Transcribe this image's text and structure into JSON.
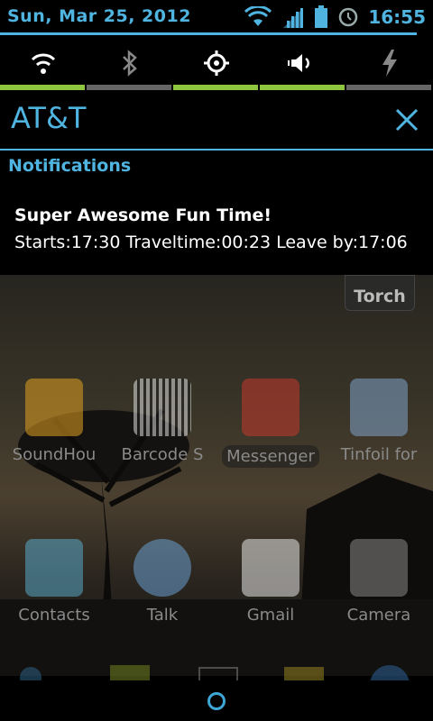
{
  "status_bar": {
    "date": "Sun, Mar 25, 2012",
    "time": "16:55",
    "icons": [
      "wifi-icon",
      "signal-icon",
      "battery-icon",
      "alarm-icon"
    ]
  },
  "quick_settings": {
    "toggles": [
      {
        "name": "wifi-toggle",
        "icon": "wifi-icon",
        "state": "on"
      },
      {
        "name": "bluetooth-toggle",
        "icon": "bluetooth-icon",
        "state": "off"
      },
      {
        "name": "gps-toggle",
        "icon": "gps-icon",
        "state": "on"
      },
      {
        "name": "sound-toggle",
        "icon": "speaker-icon",
        "state": "on"
      },
      {
        "name": "flash-toggle",
        "icon": "lightning-icon",
        "state": "off"
      }
    ],
    "colors": {
      "on": "#8ec63f",
      "off": "#666666",
      "accent": "#4fb4e0"
    }
  },
  "carrier": {
    "name": "AT&T"
  },
  "notifications": {
    "header": "Notifications",
    "items": [
      {
        "title": "Super Awesome Fun Time!",
        "text": "Starts:17:30  Traveltime:00:23 Leave by:17:06"
      }
    ]
  },
  "home": {
    "torch_label": "Torch",
    "apps": [
      {
        "label": "SoundHou",
        "icon": "soundhound-icon"
      },
      {
        "label": "Barcode S",
        "icon": "barcode-icon"
      },
      {
        "label": "Messenger",
        "icon": "messenger-icon"
      },
      {
        "label": "Tinfoil for",
        "icon": "tinfoil-icon"
      },
      {
        "label": "Contacts",
        "icon": "contacts-icon"
      },
      {
        "label": "Talk",
        "icon": "talk-icon"
      },
      {
        "label": "Gmail",
        "icon": "gmail-icon"
      },
      {
        "label": "Camera",
        "icon": "camera-icon"
      }
    ]
  }
}
